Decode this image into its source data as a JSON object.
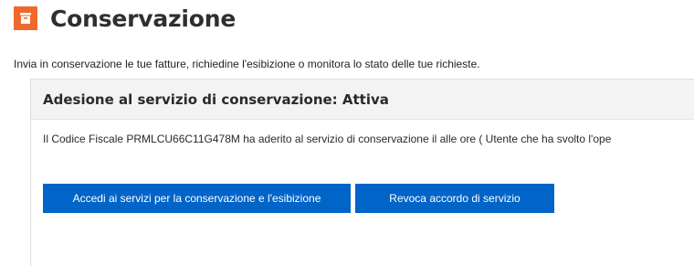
{
  "header": {
    "icon": "archive-icon",
    "icon_color": "#f0692c",
    "title": "Conservazione"
  },
  "description": "Invia in conservazione le tue fatture, richiedine l'esibizione o monitora lo stato delle tue richieste.",
  "panel": {
    "title": "Adesione al servizio di conservazione: Attiva",
    "info_text": "Il Codice Fiscale PRMLCU66C11G478M ha aderito al servizio di conservazione il alle ore ( Utente che ha svolto l'ope",
    "buttons": {
      "services_label": "Accedi ai servizi per la conservazione e l'esibizione",
      "revoke_label": "Revoca accordo di servizio"
    }
  },
  "colors": {
    "accent": "#0064c8",
    "brand": "#f0692c"
  }
}
